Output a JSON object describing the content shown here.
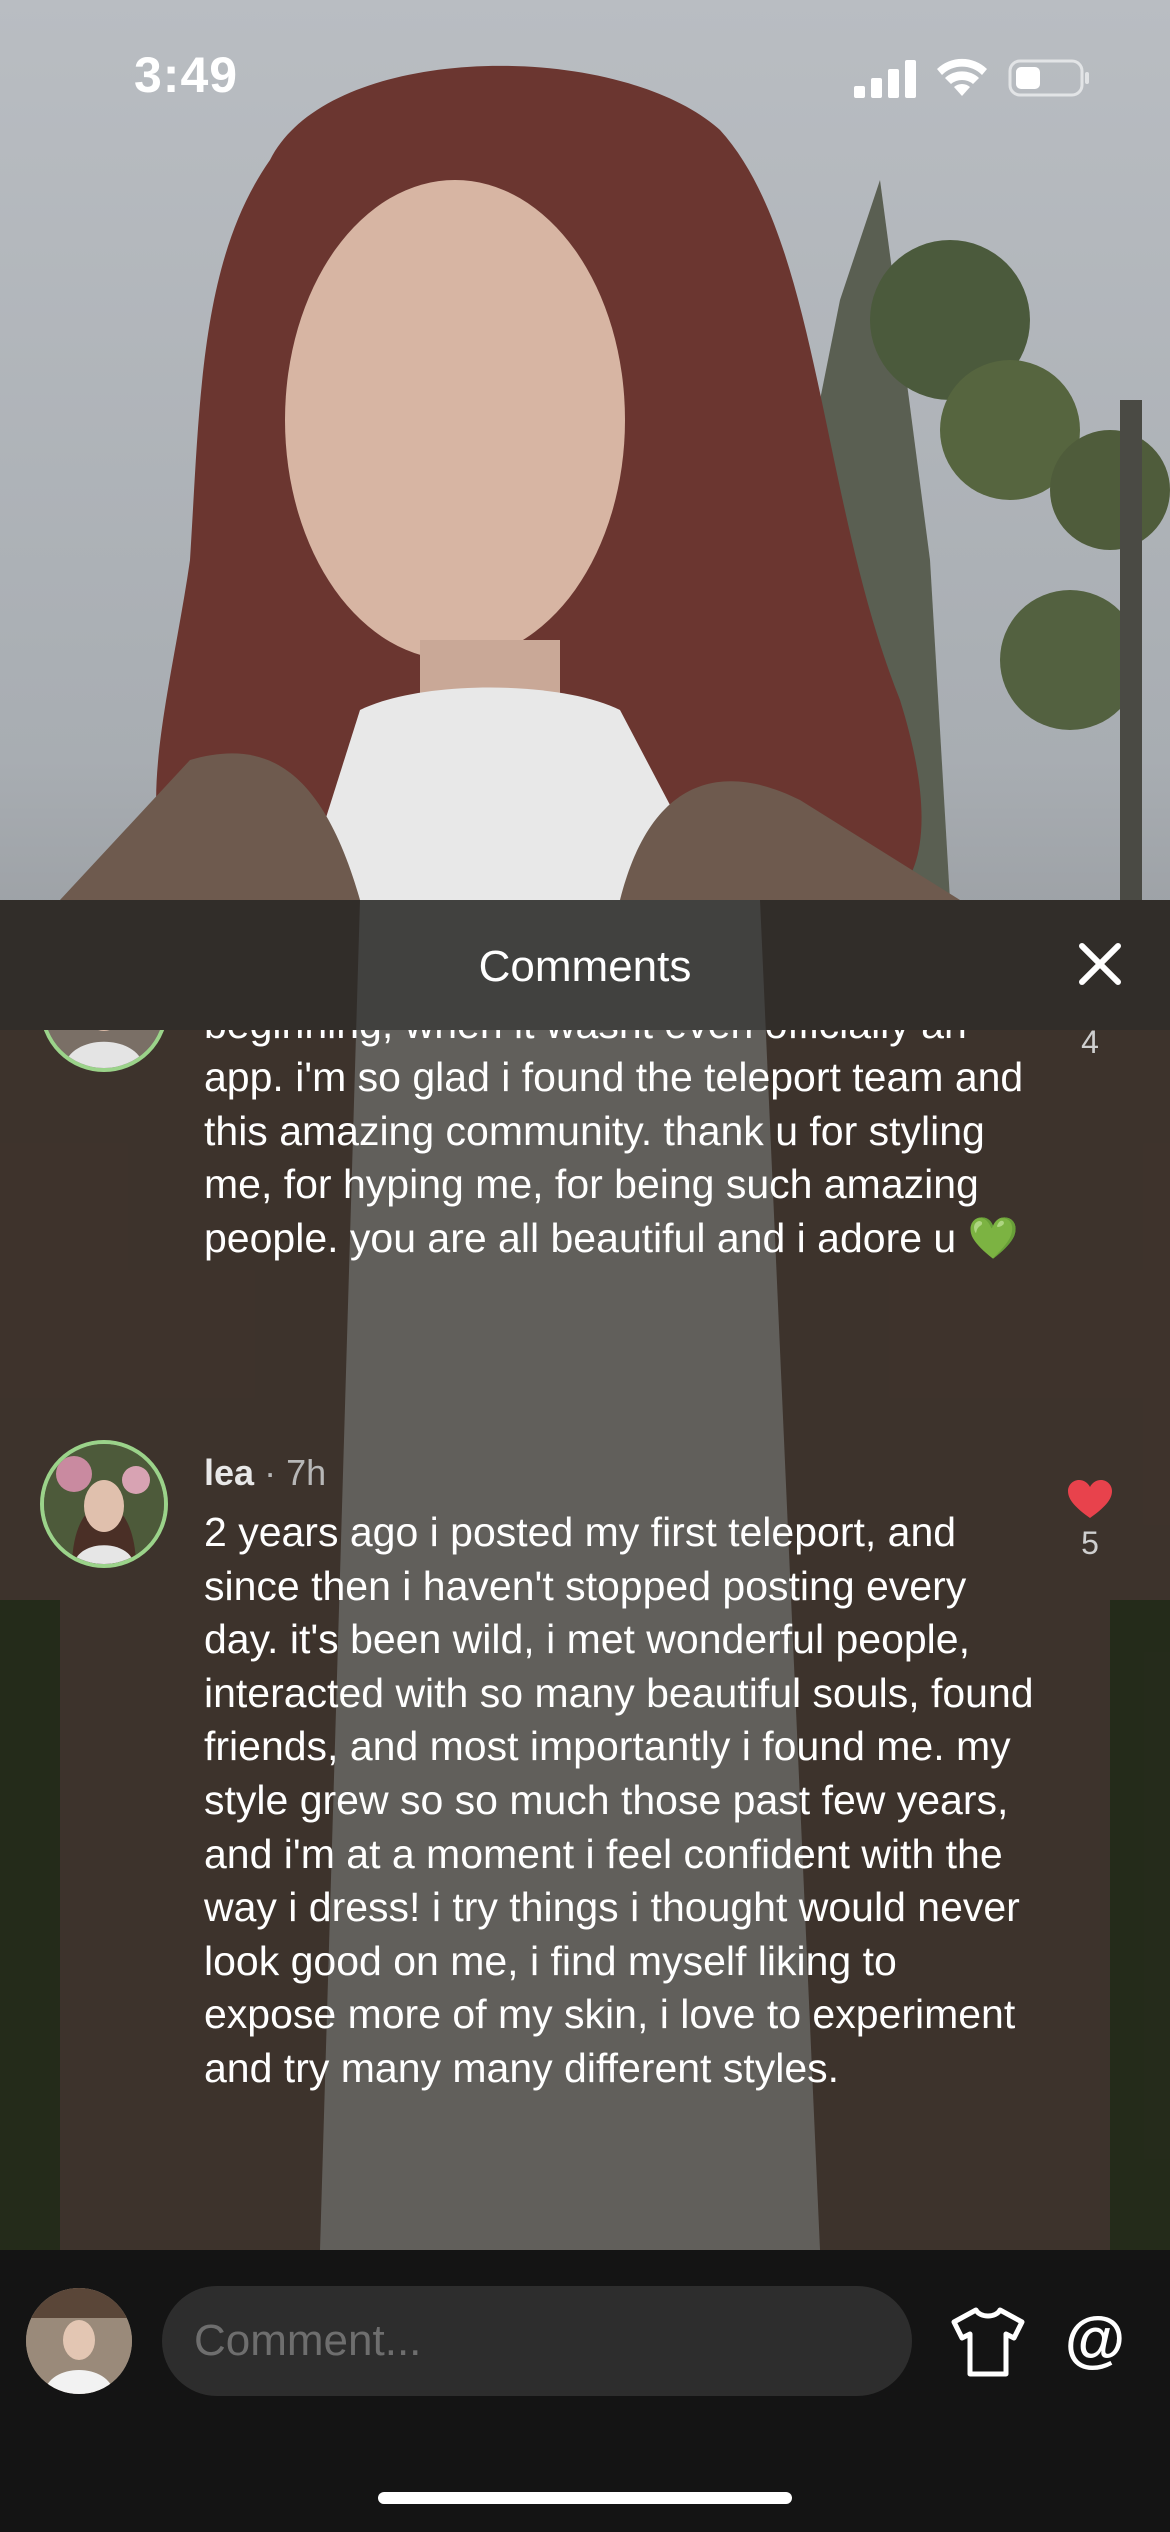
{
  "status_bar": {
    "time": "3:49",
    "icons": [
      "signal-icon",
      "wifi-icon",
      "battery-icon"
    ]
  },
  "header": {
    "title": "Comments",
    "close_icon": "close-icon"
  },
  "comments": [
    {
      "text": "i'm so glad i found this app, at its very beginning, when it wasnt even officially an app. i'm so glad i found the teleport team and this amazing community. thank u for styling me, for hyping me, for being such amazing people. you are all beautiful and i adore u 💚",
      "likes": "4",
      "liked": false
    },
    {
      "user": "lea",
      "time_ago": "7h",
      "text": "2 years ago i posted my first teleport, and since then i haven't stopped posting every day. it's been wild, i met wonderful people, interacted with so many beautiful souls, found friends, and most importantly i found me. my style grew so so much those past few years, and i'm at a moment i feel confident with the way i dress! i try things i thought would never look good on me, i find myself liking to expose more of my skin, i love to experiment and try many many different styles.",
      "likes": "5",
      "liked": true
    }
  ],
  "composer": {
    "placeholder": "Comment...",
    "outfit_icon": "tshirt-icon",
    "mention_label": "@"
  },
  "colors": {
    "like_red": "#e8424c",
    "avatar_ring": "#9bd38a",
    "background": "#141414"
  }
}
